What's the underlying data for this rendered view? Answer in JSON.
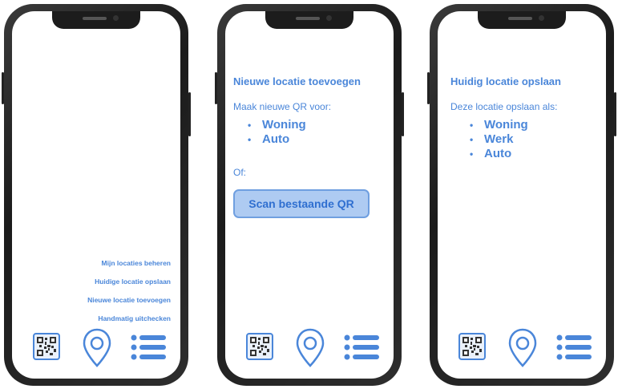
{
  "phones": [
    {
      "menu_links": [
        "Mijn locaties beheren",
        "Huidige locatie opslaan",
        "Nieuwe locatie toevoegen",
        "Handmatig uitchecken"
      ],
      "nav": {
        "left_icon": "qr-code-icon",
        "center_icon": "location-pin-icon",
        "right_icon": "menu-list-icon"
      }
    },
    {
      "title": "Nieuwe locatie toevoegen",
      "subtitle": "Maak nieuwe QR voor:",
      "options": [
        "Woning",
        "Auto"
      ],
      "or_label": "Of:",
      "scan_button": "Scan bestaande QR",
      "nav": {
        "left_icon": "qr-code-icon",
        "center_icon": "location-pin-icon",
        "right_icon": "menu-list-icon"
      }
    },
    {
      "title": "Huidig locatie opslaan",
      "subtitle": "Deze locatie opslaan als:",
      "options": [
        "Woning",
        "Werk",
        "Auto"
      ],
      "nav": {
        "left_icon": "qr-code-icon",
        "center_icon": "location-pin-icon",
        "right_icon": "menu-list-icon"
      }
    }
  ],
  "colors": {
    "accent": "#4a86d9",
    "button_fill": "#aecbf2",
    "frame": "#1f1f1f"
  }
}
